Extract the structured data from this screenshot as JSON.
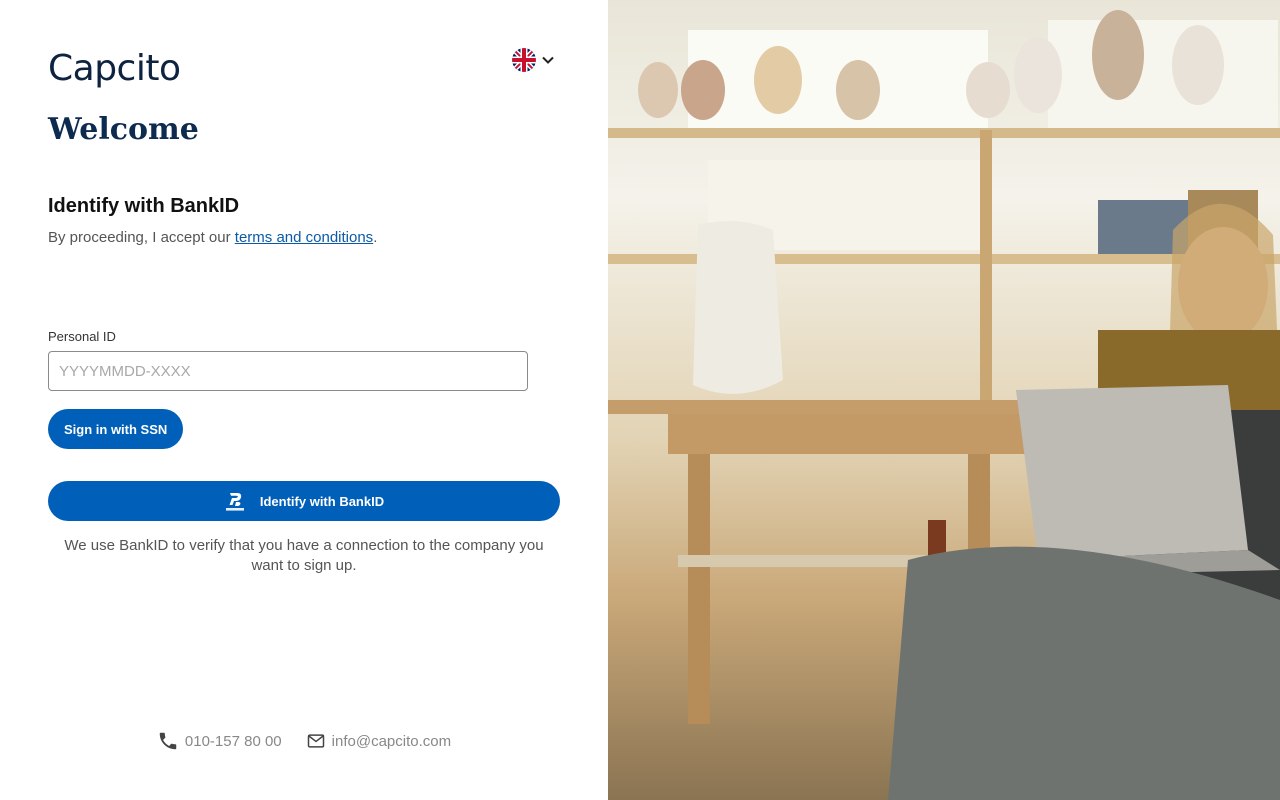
{
  "brand": {
    "logo_text": "Capcito"
  },
  "language": {
    "current": "English",
    "flag_icon": "uk-flag-icon"
  },
  "header": {
    "welcome": "Welcome"
  },
  "identify": {
    "title": "Identify with BankID",
    "terms_prefix": "By proceeding, I accept our ",
    "terms_link": "terms and conditions",
    "terms_suffix": "."
  },
  "form": {
    "personal_id_label": "Personal ID",
    "personal_id_placeholder": "YYYYMMDD-XXXX",
    "personal_id_value": "",
    "ssn_button_label": "Sign in with SSN",
    "bankid_button_label": "Identify with BankID",
    "bankid_note": "We use BankID to verify that you have a connection to the company you want to sign up."
  },
  "contact": {
    "phone": "010-157 80 00",
    "email": "info@capcito.com"
  },
  "colors": {
    "primary": "#005fb8",
    "heading": "#0d2a4f",
    "link": "#0a5aa8"
  }
}
